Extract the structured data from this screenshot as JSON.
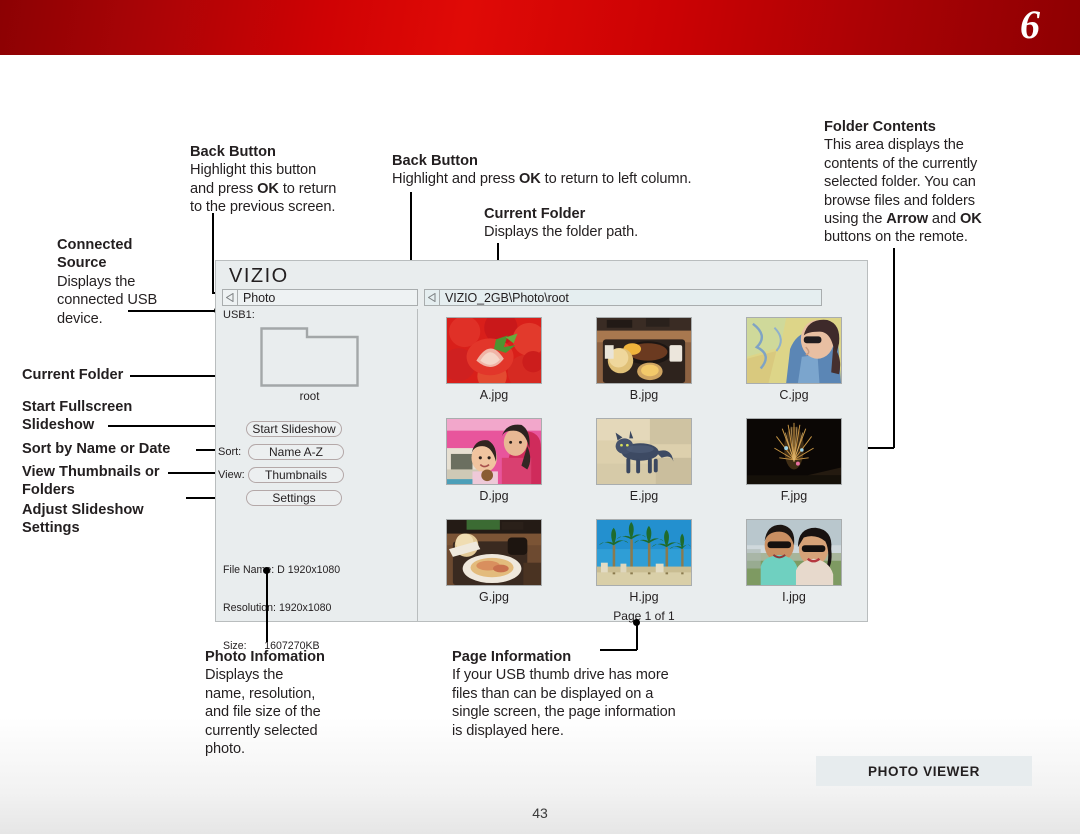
{
  "header": {
    "chapter_number": "6"
  },
  "annotations": {
    "back_button_left": {
      "title": "Back Button",
      "body_lines": [
        "Highlight this button",
        "and press OK to return",
        "to the previous screen."
      ],
      "bold_inline": "OK"
    },
    "connected_source": {
      "title_line1": "Connected",
      "title_line2": "Source",
      "body_lines": [
        "Displays the",
        "connected USB",
        "device."
      ]
    },
    "back_button_mid": {
      "title": "Back Button",
      "body": "Highlight and press OK to return to left column."
    },
    "current_folder_mid": {
      "title": "Current Folder",
      "body": "Displays the folder path."
    },
    "folder_contents": {
      "title": "Folder Contents",
      "body_lines": [
        "This area displays the",
        "contents of the currently",
        "selected folder. You can",
        "browse files and folders",
        "using the Arrow and OK",
        "buttons on the remote."
      ]
    },
    "left_labels": {
      "current_folder": "Current Folder",
      "start_fullscreen_line1": "Start Fullscreen",
      "start_fullscreen_line2": "Slideshow",
      "sort_by": "Sort by Name or Date",
      "view_thumbs_line1": "View Thumbnails or",
      "view_thumbs_line2": "Folders",
      "adjust_line1": "Adjust Slideshow",
      "adjust_line2": "Settings"
    },
    "photo_information": {
      "title": "Photo Infomation",
      "body_lines": [
        "Displays the",
        "name, resolution,",
        "and file size of the",
        "currently selected",
        "photo."
      ]
    },
    "page_information": {
      "title": "Page Information",
      "body_lines": [
        "If your USB thumb drive has more",
        "files than can be displayed on a",
        "single screen, the page information",
        "is displayed here."
      ]
    }
  },
  "tv": {
    "brand": "VIZIO",
    "breadcrumb_left": "Photo",
    "breadcrumb_right": "VIZIO_2GB\\Photo\\root",
    "source_label": "USB1:",
    "folder_name": "root",
    "buttons": {
      "start_slideshow": "Start Slideshow",
      "sort_label": "Sort:",
      "sort_value": "Name A-Z",
      "view_label": "View:",
      "view_value": "Thumbnails",
      "settings": "Settings"
    },
    "file_info": {
      "file_name_label": "File Name:",
      "file_name_value": "D 1920x1080",
      "resolution_label": "Resolution:",
      "resolution_value": "1920x1080",
      "size_label": "Size:",
      "size_value": "1607270KB"
    },
    "thumbnails": [
      {
        "caption": "A.jpg",
        "subject": "strawberries"
      },
      {
        "caption": "B.jpg",
        "subject": "food-tray"
      },
      {
        "caption": "C.jpg",
        "subject": "woman-sunglasses-map"
      },
      {
        "caption": "D.jpg",
        "subject": "two-girls-pink-room"
      },
      {
        "caption": "E.jpg",
        "subject": "blue-cat"
      },
      {
        "caption": "F.jpg",
        "subject": "fireworks-dark"
      },
      {
        "caption": "G.jpg",
        "subject": "pasta-plate"
      },
      {
        "caption": "H.jpg",
        "subject": "palm-trees-sky"
      },
      {
        "caption": "I.jpg",
        "subject": "couple-sunglasses"
      }
    ],
    "page_info": "Page 1 of 1"
  },
  "footer": {
    "badge": "PHOTO VIEWER",
    "page_number": "43"
  },
  "colors": {
    "header_red": "#cf0204",
    "screen_bg": "#e9edee",
    "badge_bg": "#e7ecee",
    "text": "#231f20"
  }
}
